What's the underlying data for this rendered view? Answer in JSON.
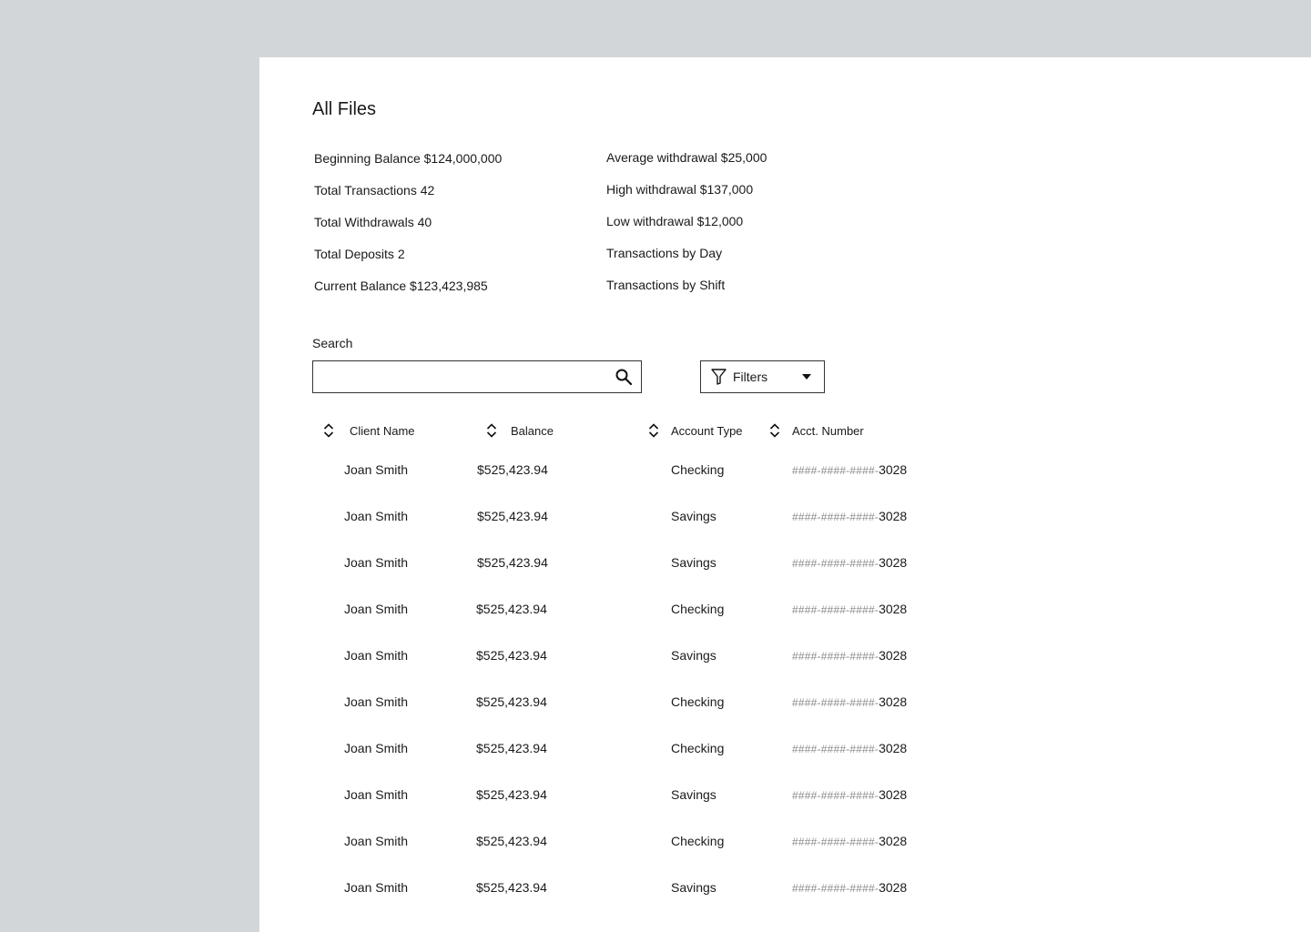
{
  "page": {
    "title": "All Files"
  },
  "stats_left": [
    "Beginning Balance $124,000,000",
    "Total Transactions 42",
    "Total Withdrawals 40",
    "Total Deposits 2",
    "Current Balance $123,423,985"
  ],
  "stats_right": [
    "Average withdrawal $25,000",
    "High withdrawal $137,000",
    "Low withdrawal $12,000",
    "Transactions by Day",
    "Transactions by Shift"
  ],
  "search": {
    "label": "Search",
    "value": "",
    "placeholder": ""
  },
  "filters": {
    "label": "Filters"
  },
  "table": {
    "columns": [
      "Client Name",
      "Balance",
      "Account Type",
      "Acct. Number"
    ],
    "rows": [
      {
        "name": "Joan Smith",
        "balance": "$525,423.94",
        "type": "Checking",
        "acct_mask": "####-####-####-",
        "acct_last": "3028"
      },
      {
        "name": "Joan Smith",
        "balance": "$525,423.94",
        "type": "Savings",
        "acct_mask": "####-####-####-",
        "acct_last": "3028"
      },
      {
        "name": "Joan Smith",
        "balance": "$525,423.94",
        "type": "Savings",
        "acct_mask": "####-####-####-",
        "acct_last": "3028"
      },
      {
        "name": "Joan Smith",
        "balance": "$525,423.94",
        "type": "Checking",
        "acct_mask": "####-####-####-",
        "acct_last": "3028"
      },
      {
        "name": "Joan Smith",
        "balance": "$525,423.94",
        "type": "Savings",
        "acct_mask": "####-####-####-",
        "acct_last": "3028"
      },
      {
        "name": "Joan Smith",
        "balance": "$525,423.94",
        "type": "Checking",
        "acct_mask": "####-####-####-",
        "acct_last": "3028"
      },
      {
        "name": "Joan Smith",
        "balance": "$525,423.94",
        "type": "Checking",
        "acct_mask": "####-####-####-",
        "acct_last": "3028"
      },
      {
        "name": "Joan Smith",
        "balance": "$525,423.94",
        "type": "Savings",
        "acct_mask": "####-####-####-",
        "acct_last": "3028"
      },
      {
        "name": "Joan Smith",
        "balance": "$525,423.94",
        "type": "Checking",
        "acct_mask": "####-####-####-",
        "acct_last": "3028"
      },
      {
        "name": "Joan Smith",
        "balance": "$525,423.94",
        "type": "Savings",
        "acct_mask": "####-####-####-",
        "acct_last": "3028"
      }
    ]
  },
  "icons": {
    "search": "search-icon",
    "filter": "filter-funnel-icon",
    "dropdown": "caret-down-icon",
    "sort": "sort-up-down-icon"
  },
  "colors": {
    "background": "#d3d6d9",
    "panel": "#ffffff",
    "text": "#1a1a1a",
    "muted": "#8a8a8a"
  }
}
